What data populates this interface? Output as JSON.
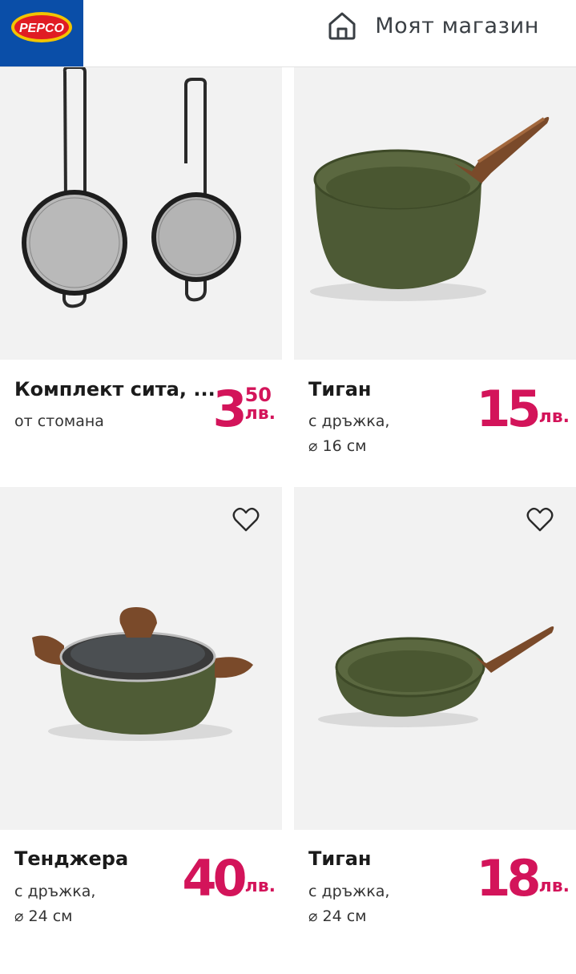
{
  "header": {
    "logo_text": "PEPCO",
    "store_label": "Моят магазин",
    "home_icon": "home-icon"
  },
  "colors": {
    "brand_blue": "#0a4ea8",
    "price_pink": "#d3145a",
    "image_bg": "#f2f2f2"
  },
  "products": [
    {
      "title": "Комплект сита, ...",
      "desc_line1": "от стомана",
      "desc_line2": "",
      "price_main": "3",
      "price_cents": "50",
      "currency": "лв.",
      "has_favorite": false
    },
    {
      "title": "Тиган",
      "desc_line1": "с дръжка,",
      "desc_line2": "⌀ 16 см",
      "price_main": "15",
      "price_cents": "",
      "currency": "лв.",
      "has_favorite": false
    },
    {
      "title": "Тенджера",
      "desc_line1": "с дръжка,",
      "desc_line2": "⌀ 24 см",
      "price_main": "40",
      "price_cents": "",
      "currency": "лв.",
      "has_favorite": true
    },
    {
      "title": "Тиган",
      "desc_line1": "с дръжка,",
      "desc_line2": "⌀ 24 см",
      "price_main": "18",
      "price_cents": "",
      "currency": "лв.",
      "has_favorite": true
    }
  ]
}
